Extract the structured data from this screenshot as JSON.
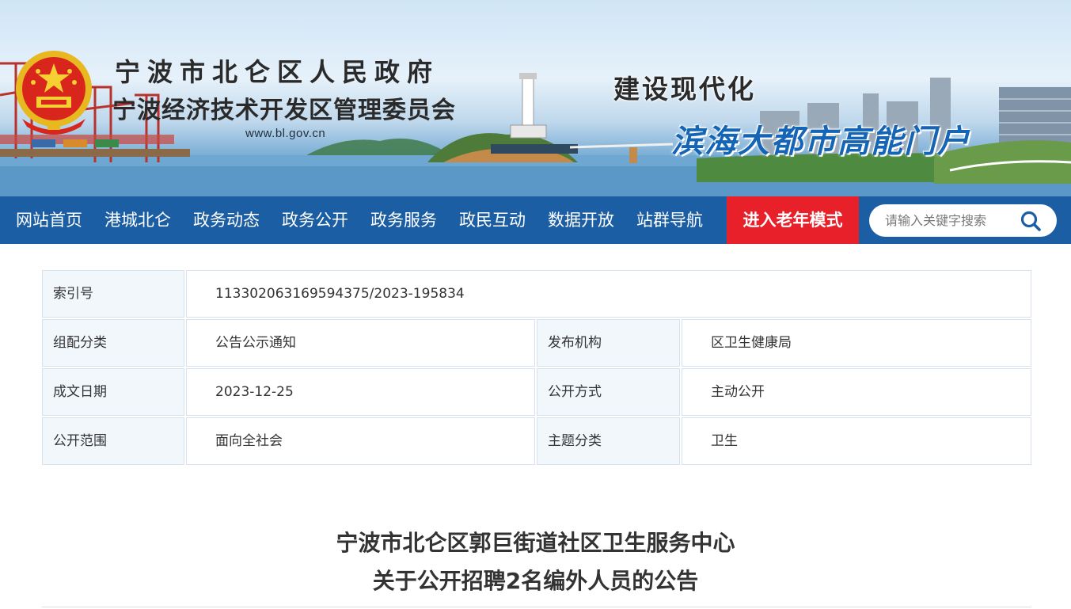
{
  "banner": {
    "site_name_line1": "宁波市北仑区人民政府",
    "site_name_line2": "宁波经济技术开发区管理委员会",
    "url": "www.bl.gov.cn",
    "slogan_line1": "建设现代化",
    "slogan_line2": "滨海大都市高能门户"
  },
  "nav": {
    "items": [
      {
        "label": "网站首页"
      },
      {
        "label": "港城北仑"
      },
      {
        "label": "政务动态"
      },
      {
        "label": "政务公开"
      },
      {
        "label": "政务服务"
      },
      {
        "label": "政民互动"
      },
      {
        "label": "数据开放"
      },
      {
        "label": "站群导航"
      }
    ],
    "elder_mode": "进入老年模式",
    "search_placeholder": "请输入关键字搜索",
    "search_icon": "search-icon"
  },
  "info": {
    "index_label": "索引号",
    "index_value": "113302063169594375/2023-195834",
    "category_label": "组配分类",
    "category_value": "公告公示通知",
    "publisher_label": "发布机构",
    "publisher_value": "区卫生健康局",
    "date_label": "成文日期",
    "date_value": "2023-12-25",
    "disclosure_label": "公开方式",
    "disclosure_value": "主动公开",
    "scope_label": "公开范围",
    "scope_value": "面向全社会",
    "topic_label": "主题分类",
    "topic_value": "卫生"
  },
  "document": {
    "title_line1": "宁波市北仑区郭巨街道社区卫生服务中心",
    "title_line2": "关于公开招聘2名编外人员的公告"
  },
  "colors": {
    "nav_bg": "#1b5ea4",
    "elder_bg": "#e8202a",
    "label_bg": "#f2f7fc",
    "border": "#d6e2ef",
    "slogan_blue": "#1565b6"
  }
}
